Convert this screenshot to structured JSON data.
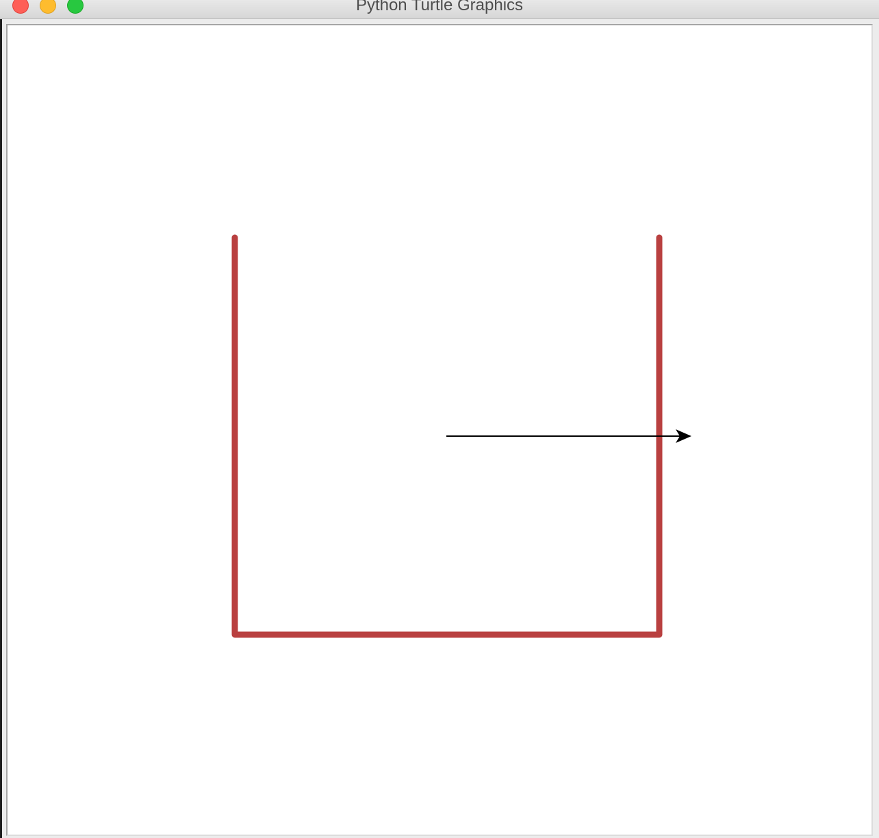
{
  "window": {
    "title": "Python Turtle Graphics"
  },
  "drawing": {
    "pen_color": "#b94040",
    "turtle_color": "#000000",
    "turtle_shape": "arrow-icon",
    "turtle_heading": "east"
  }
}
